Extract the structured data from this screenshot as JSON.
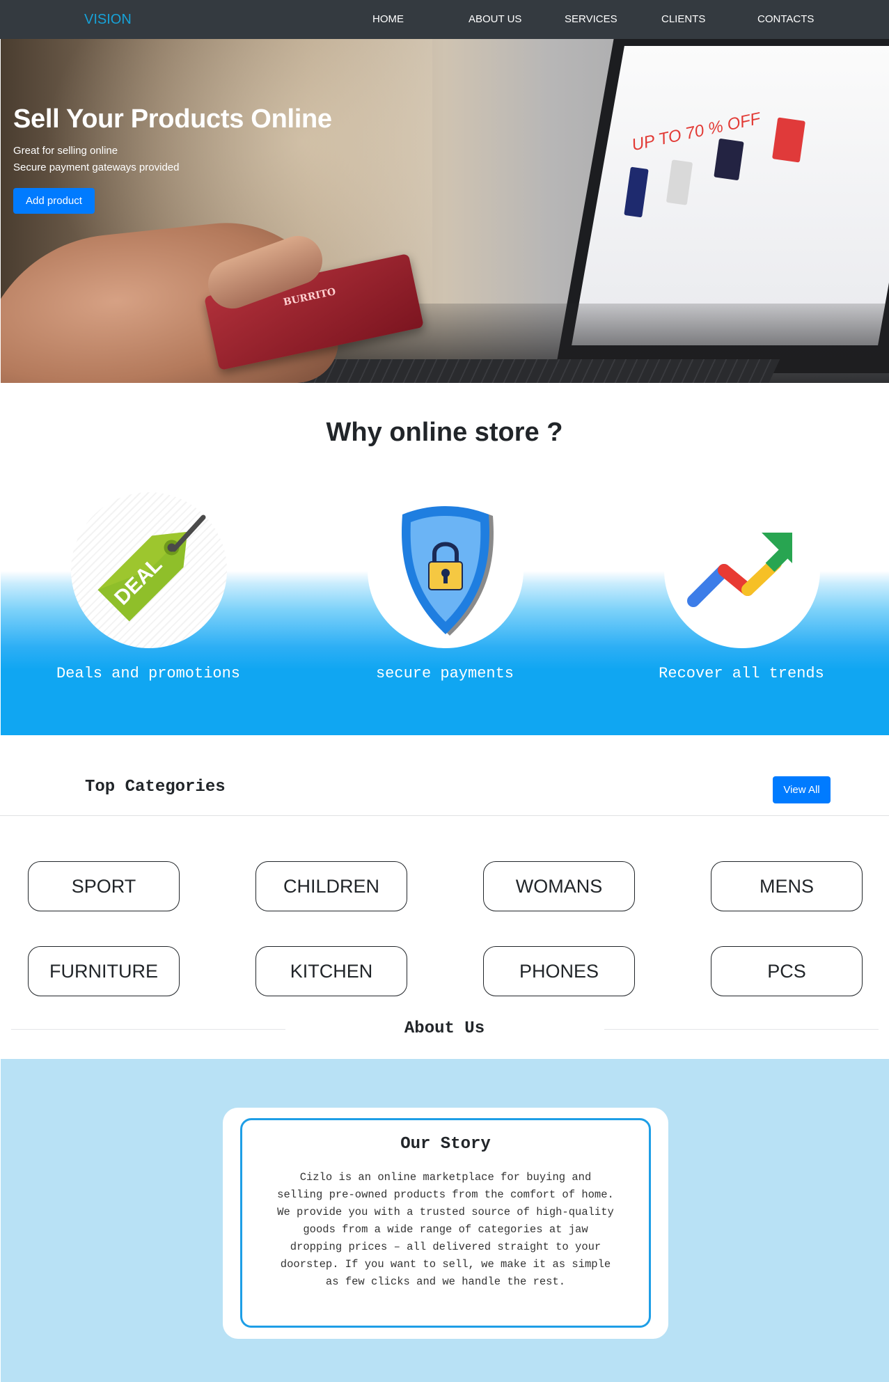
{
  "navbar": {
    "brand": "VISION",
    "items": [
      "HOME",
      "ABOUT US",
      "SERVICES",
      "CLIENTS",
      "CONTACTS"
    ]
  },
  "hero": {
    "title": "Sell Your Products Online",
    "subtitles": [
      "Great for selling online",
      "Secure payment gateways provided"
    ],
    "button_label": "Add product",
    "image_text": {
      "card": "BURRITO",
      "screen_banner": "UP TO 70 % OFF"
    }
  },
  "why": {
    "title": "Why online store ?",
    "features": [
      {
        "label": "Deals and promotions",
        "icon": "deal-tag-icon",
        "icon_text": "DEAL"
      },
      {
        "label": "secure payments",
        "icon": "shield-lock-icon"
      },
      {
        "label": "Recover all trends",
        "icon": "trend-arrow-icon"
      }
    ]
  },
  "categories": {
    "heading": "Top Categories",
    "view_all_label": "View All",
    "items": [
      "SPORT",
      "CHILDREN",
      "WOMANS",
      "MENS",
      "FURNITURE",
      "KITCHEN",
      "PHONES",
      "PCS"
    ]
  },
  "about": {
    "heading": "About Us",
    "story_title": "Our Story",
    "story_text": "Cizlo is an online marketplace for buying and selling pre-owned products from the comfort of home. We provide you with a trusted source of high-quality goods from a wide range of categories at jaw dropping prices – all delivered straight to your doorstep. If you want to sell, we make it as simple as few clicks and we handle the rest."
  },
  "colors": {
    "navbar_bg": "#343a40",
    "brand": "#17a2d8",
    "primary_button": "#007bff",
    "feature_band": "#10a6f2",
    "about_band": "#b8e1f5",
    "story_border": "#1e9ee6"
  }
}
